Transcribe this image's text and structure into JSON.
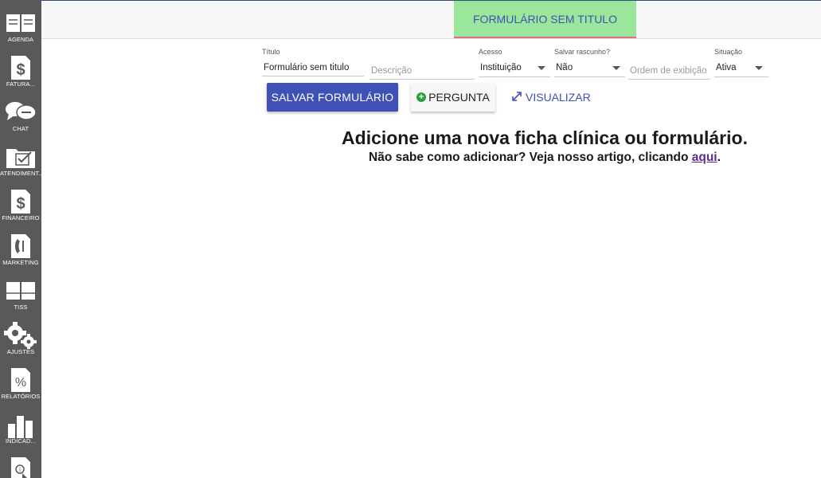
{
  "sidebar": {
    "items": [
      {
        "label": "AGENDA",
        "icon": "agenda-calendar-icon"
      },
      {
        "label": "FATURA...",
        "icon": "dollar-document-icon"
      },
      {
        "label": "CHAT",
        "icon": "chat-bubbles-icon"
      },
      {
        "label": "ATENDIMENT...",
        "icon": "folder-check-icon"
      },
      {
        "label": "FINANCEIRO",
        "icon": "dollar-document-icon"
      },
      {
        "label": "MARKETING",
        "icon": "phone-document-icon"
      },
      {
        "label": "TISS",
        "icon": "tiss-book-icon"
      },
      {
        "label": "AJUSTES",
        "icon": "gears-icon"
      },
      {
        "label": "RELATÓRIOS",
        "icon": "percent-document-icon"
      },
      {
        "label": "INDICAD...",
        "icon": "bar-chart-icon"
      },
      {
        "label": "",
        "icon": "help-document-icon"
      }
    ]
  },
  "header": {
    "active_tab": "FORMULÁRIO SEM TITULO",
    "tab_color": "#9ae69a",
    "tab_text_color": "#3f51b5"
  },
  "form": {
    "title": {
      "label": "Título",
      "value": "Formulário sem titulo"
    },
    "description": {
      "placeholder": "Descrição"
    },
    "access": {
      "label": "Acesso",
      "value": "Instituição"
    },
    "save_draft": {
      "label": "Salvar rascunho?",
      "value": "Não"
    },
    "display_order": {
      "placeholder": "Ordem de exibição"
    },
    "status": {
      "label": "Situação",
      "value": "Ativa"
    }
  },
  "actions": {
    "save_label": "SALVAR FORMULÁRIO",
    "question_label": "PERGUNTA",
    "view_label": "VISUALIZAR"
  },
  "empty_state": {
    "title": "Adicione uma nova ficha clínica ou formulário.",
    "subtitle_prefix": "Não sabe como adicionar? Veja nosso artigo, clicando ",
    "link_text": "aqui",
    "subtitle_suffix": "."
  },
  "colors": {
    "sidebar_bg": "#58595b",
    "primary": "#3f51b5",
    "plus_green": "#2e9e3f"
  }
}
